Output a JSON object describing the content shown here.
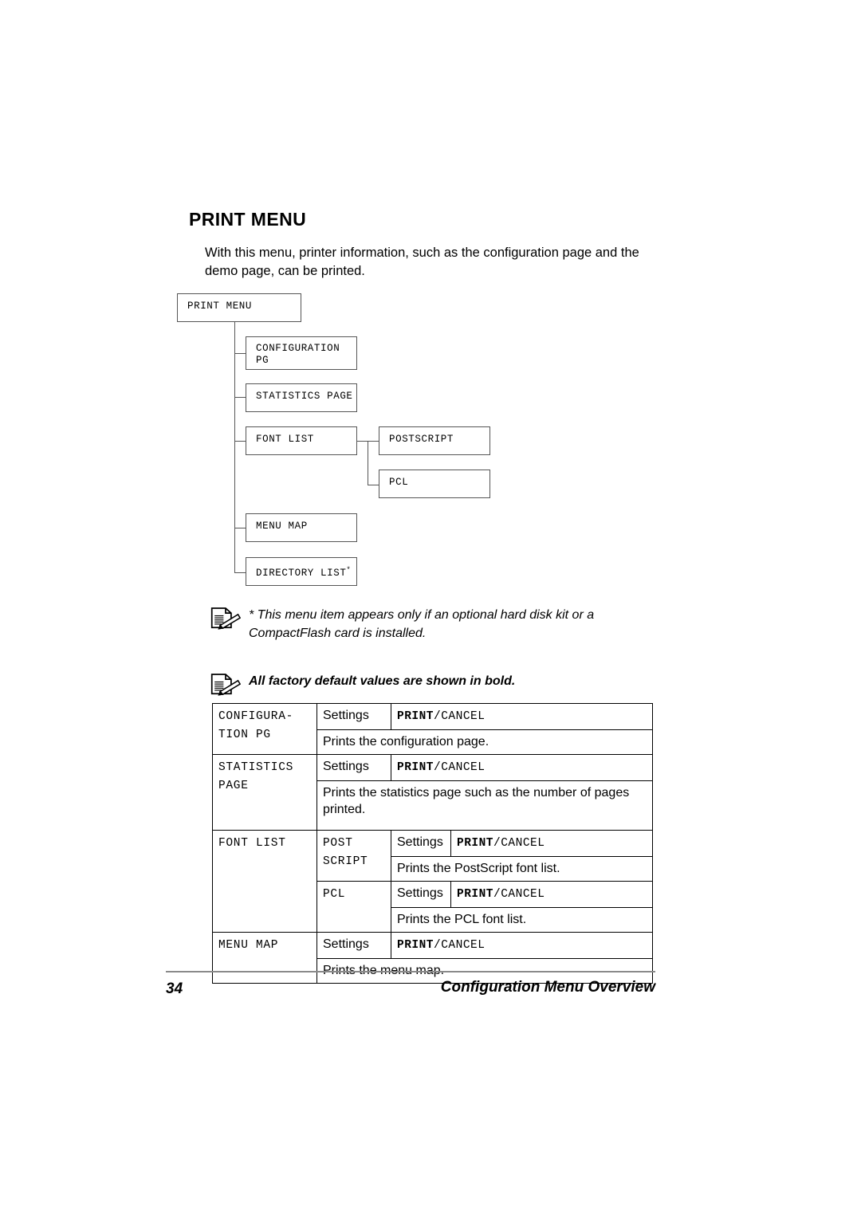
{
  "page": {
    "title": "PRINT MENU",
    "intro": "With this menu, printer information, such as the configuration page and the demo page, can be printed."
  },
  "diagram": {
    "root": {
      "label": "PRINT MENU"
    },
    "children": [
      {
        "label": "CONFIGURATION PG"
      },
      {
        "label": "STATISTICS PAGE"
      },
      {
        "label": "FONT LIST"
      },
      {
        "label": "MENU MAP"
      },
      {
        "label": "DIRECTORY LIST",
        "footnote": "*"
      }
    ],
    "font_list_children": [
      {
        "label": "POSTSCRIPT"
      },
      {
        "label": "PCL"
      }
    ]
  },
  "notes": [
    {
      "icon": "note-pencil-icon",
      "text": "* This menu item appears only if an optional hard disk kit or a CompactFlash card is installed.",
      "bold": false
    },
    {
      "icon": "note-pencil-icon",
      "text": "All factory default values are shown in bold.",
      "bold": true
    }
  ],
  "table": {
    "rows": {
      "configuration_pg": {
        "menu": "CONFIGURA-\nTION PG",
        "settings_label": "Settings",
        "value_bold": "PRINT",
        "value_sep": "/",
        "value_rest": "CANCEL",
        "description": "Prints the configuration page."
      },
      "statistics_page": {
        "menu": "STATISTICS\nPAGE",
        "settings_label": "Settings",
        "value_bold": "PRINT",
        "value_sep": "/",
        "value_rest": "CANCEL",
        "description": "Prints the statistics page such as the number of pages printed."
      },
      "font_list": {
        "menu": "FONT LIST",
        "postscript": {
          "sub_menu": "POST\nSCRIPT",
          "settings_label": "Settings",
          "value_bold": "PRINT",
          "value_sep": "/",
          "value_rest": "CANCEL",
          "description": "Prints the PostScript font list."
        },
        "pcl": {
          "sub_menu": "PCL",
          "settings_label": "Settings",
          "value_bold": "PRINT",
          "value_sep": "/",
          "value_rest": "CANCEL",
          "description": "Prints the PCL font list."
        }
      },
      "menu_map": {
        "menu": "MENU MAP",
        "settings_label": "Settings",
        "value_bold": "PRINT",
        "value_sep": "/",
        "value_rest": "CANCEL",
        "description": "Prints the menu map."
      }
    }
  },
  "footer": {
    "page_number": "34",
    "section_title": "Configuration Menu Overview"
  },
  "colors": {
    "text": "#000000",
    "box_border": "#555555",
    "table_border": "#000000",
    "footer_rule": "#8a8a8a",
    "background": "#ffffff"
  }
}
